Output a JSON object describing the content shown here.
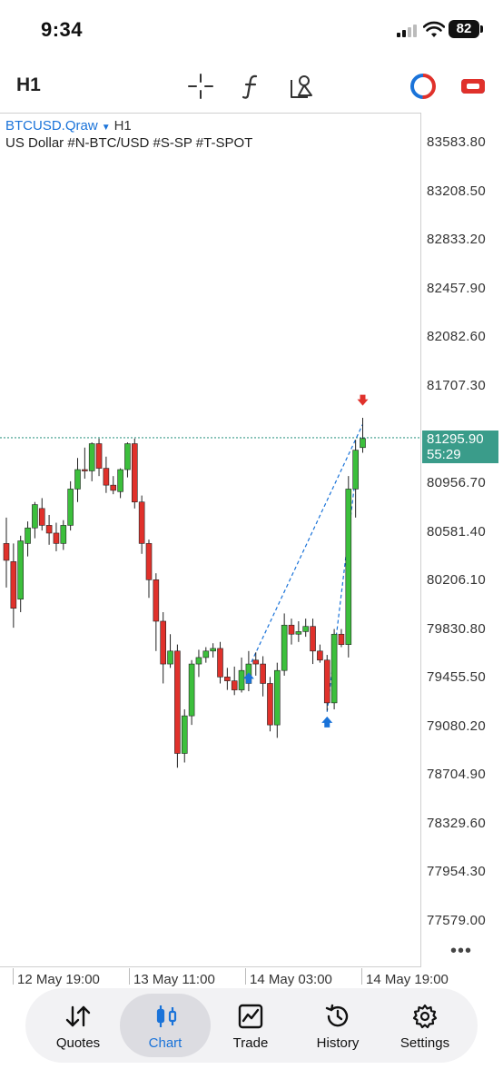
{
  "status": {
    "time": "9:34",
    "battery": "82"
  },
  "toolbar": {
    "timeframe": "H1",
    "icons": [
      "crosshair-icon",
      "function-icon",
      "objects-icon",
      "oneclick-trading-icon",
      "account-toggle-icon"
    ]
  },
  "chart": {
    "symbol": "BTCUSD.Qraw",
    "symbol_arrow": "▼",
    "timeframe": "H1",
    "description": "US Dollar #N-BTC/USD #S-SP #T-SPOT",
    "prices": [
      "83583.80",
      "83208.50",
      "82833.20",
      "82457.90",
      "82082.60",
      "81707.30",
      "80956.70",
      "80581.40",
      "80206.10",
      "79830.80",
      "79455.50",
      "79080.20",
      "78704.90",
      "78329.60",
      "77954.30",
      "77579.00"
    ],
    "current_price": "81295.90",
    "countdown": "55:29",
    "times": [
      "12 May 19:00",
      "13 May 11:00",
      "14 May 03:00",
      "14 May 19:00"
    ],
    "more": "•••",
    "colors": {
      "bull": "#3cbf3c",
      "bear": "#e0312b",
      "grid_line": "#3a9c8a",
      "trade_line": "#1a73d9"
    }
  },
  "chart_data": {
    "type": "candlestick",
    "symbol": "BTCUSD.Qraw",
    "timeframe": "H1",
    "ylim": [
      77400,
      83800
    ],
    "y_ticks": [
      83583.8,
      83208.5,
      82833.2,
      82457.9,
      82082.6,
      81707.3,
      80956.7,
      80581.4,
      80206.1,
      79830.8,
      79455.5,
      79080.2,
      78704.9,
      78329.6,
      77954.3,
      77579.0
    ],
    "x_ticks": [
      "12 May 19:00",
      "13 May 11:00",
      "14 May 03:00",
      "14 May 19:00"
    ],
    "current_price": 81295.9,
    "candles": [
      {
        "o": 80480,
        "h": 80680,
        "l": 80140,
        "c": 80350
      },
      {
        "o": 80340,
        "h": 80480,
        "l": 79830,
        "c": 79980
      },
      {
        "o": 80050,
        "h": 80540,
        "l": 79950,
        "c": 80500
      },
      {
        "o": 80480,
        "h": 80650,
        "l": 80380,
        "c": 80600
      },
      {
        "o": 80600,
        "h": 80800,
        "l": 80520,
        "c": 80780
      },
      {
        "o": 80750,
        "h": 80830,
        "l": 80580,
        "c": 80620
      },
      {
        "o": 80620,
        "h": 80700,
        "l": 80470,
        "c": 80560
      },
      {
        "o": 80560,
        "h": 80640,
        "l": 80420,
        "c": 80480
      },
      {
        "o": 80480,
        "h": 80660,
        "l": 80430,
        "c": 80620
      },
      {
        "o": 80620,
        "h": 80960,
        "l": 80580,
        "c": 80900
      },
      {
        "o": 80900,
        "h": 81140,
        "l": 80800,
        "c": 81050
      },
      {
        "o": 81050,
        "h": 81220,
        "l": 80980,
        "c": 81040
      },
      {
        "o": 81040,
        "h": 81260,
        "l": 80960,
        "c": 81250
      },
      {
        "o": 81250,
        "h": 81290,
        "l": 81000,
        "c": 81060
      },
      {
        "o": 81060,
        "h": 81150,
        "l": 80870,
        "c": 80930
      },
      {
        "o": 80930,
        "h": 81000,
        "l": 80860,
        "c": 80890
      },
      {
        "o": 80880,
        "h": 81060,
        "l": 80830,
        "c": 81050
      },
      {
        "o": 81050,
        "h": 81260,
        "l": 80990,
        "c": 81250
      },
      {
        "o": 81250,
        "h": 81290,
        "l": 80750,
        "c": 80800
      },
      {
        "o": 80800,
        "h": 80850,
        "l": 80400,
        "c": 80480
      },
      {
        "o": 80480,
        "h": 80510,
        "l": 80060,
        "c": 80200
      },
      {
        "o": 80200,
        "h": 80250,
        "l": 79650,
        "c": 79880
      },
      {
        "o": 79880,
        "h": 79950,
        "l": 79400,
        "c": 79550
      },
      {
        "o": 79550,
        "h": 79780,
        "l": 79520,
        "c": 79650
      },
      {
        "o": 79650,
        "h": 79700,
        "l": 78750,
        "c": 78860
      },
      {
        "o": 78860,
        "h": 79200,
        "l": 78790,
        "c": 79150
      },
      {
        "o": 79150,
        "h": 79580,
        "l": 79080,
        "c": 79550
      },
      {
        "o": 79550,
        "h": 79660,
        "l": 79450,
        "c": 79600
      },
      {
        "o": 79600,
        "h": 79680,
        "l": 79560,
        "c": 79650
      },
      {
        "o": 79650,
        "h": 79710,
        "l": 79600,
        "c": 79670
      },
      {
        "o": 79670,
        "h": 79720,
        "l": 79400,
        "c": 79450
      },
      {
        "o": 79450,
        "h": 79520,
        "l": 79350,
        "c": 79420
      },
      {
        "o": 79420,
        "h": 79530,
        "l": 79310,
        "c": 79350
      },
      {
        "o": 79350,
        "h": 79600,
        "l": 79330,
        "c": 79500
      },
      {
        "o": 79400,
        "h": 79650,
        "l": 79340,
        "c": 79550
      },
      {
        "o": 79580,
        "h": 79640,
        "l": 79460,
        "c": 79550
      },
      {
        "o": 79550,
        "h": 79610,
        "l": 79300,
        "c": 79400
      },
      {
        "o": 79400,
        "h": 79450,
        "l": 79030,
        "c": 79080
      },
      {
        "o": 79080,
        "h": 79560,
        "l": 78980,
        "c": 79500
      },
      {
        "o": 79500,
        "h": 79940,
        "l": 79460,
        "c": 79850
      },
      {
        "o": 79850,
        "h": 79900,
        "l": 79700,
        "c": 79780
      },
      {
        "o": 79780,
        "h": 79880,
        "l": 79720,
        "c": 79800
      },
      {
        "o": 79800,
        "h": 79900,
        "l": 79760,
        "c": 79840
      },
      {
        "o": 79840,
        "h": 79900,
        "l": 79550,
        "c": 79650
      },
      {
        "o": 79650,
        "h": 79700,
        "l": 79560,
        "c": 79580
      },
      {
        "o": 79580,
        "h": 79620,
        "l": 79190,
        "c": 79250
      },
      {
        "o": 79250,
        "h": 79820,
        "l": 79200,
        "c": 79780
      },
      {
        "o": 79780,
        "h": 79820,
        "l": 79680,
        "c": 79700
      },
      {
        "o": 79700,
        "h": 81000,
        "l": 79600,
        "c": 80900
      },
      {
        "o": 80900,
        "h": 81280,
        "l": 80680,
        "c": 81200
      },
      {
        "o": 81220,
        "h": 81450,
        "l": 81180,
        "c": 81290
      }
    ],
    "trades": [
      {
        "type": "buy",
        "from_index": 34,
        "price": 79520,
        "to_index": 50,
        "to_price": 81400
      },
      {
        "type": "buy",
        "from_index": 45,
        "price": 79180,
        "to_index": 49,
        "to_price": 81000
      },
      {
        "type": "sell",
        "index": 50,
        "price": 81480
      }
    ]
  },
  "nav": {
    "items": [
      {
        "label": "Quotes",
        "icon": "quotes-icon"
      },
      {
        "label": "Chart",
        "icon": "chart-icon"
      },
      {
        "label": "Trade",
        "icon": "trade-icon"
      },
      {
        "label": "History",
        "icon": "history-icon"
      },
      {
        "label": "Settings",
        "icon": "settings-icon"
      }
    ],
    "active": "Chart"
  }
}
